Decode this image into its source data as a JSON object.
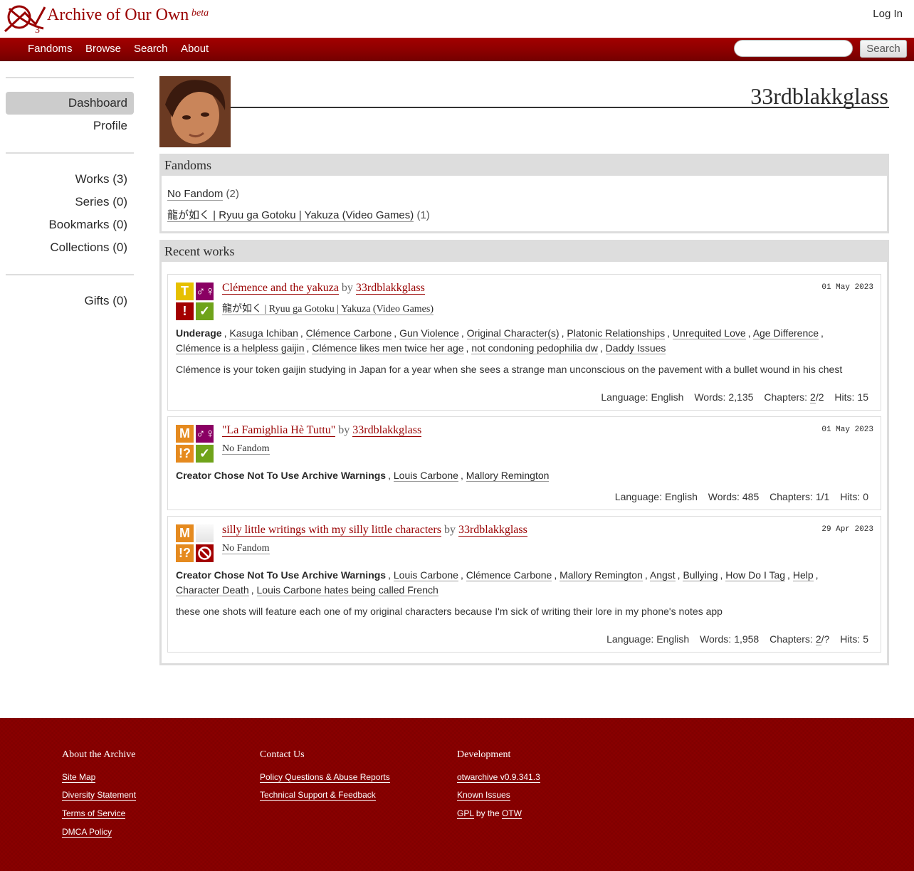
{
  "header": {
    "site_title": "Archive of Our Own",
    "beta": "beta",
    "login": "Log In",
    "logo_icon": "ao3-logo-icon"
  },
  "nav": {
    "items": [
      "Fandoms",
      "Browse",
      "Search",
      "About"
    ],
    "search_value": "",
    "search_button": "Search"
  },
  "sidebar": {
    "primary": [
      "Dashboard",
      "Profile"
    ],
    "counts": [
      "Works (3)",
      "Series (0)",
      "Bookmarks (0)",
      "Collections (0)"
    ],
    "gifts": "Gifts (0)"
  },
  "user": {
    "name": "33rdblakkglass"
  },
  "fandoms_box": {
    "heading": "Fandoms",
    "items": [
      {
        "name": "No Fandom",
        "count": "(2)"
      },
      {
        "name": "龍が如く | Ryuu ga Gotoku | Yakuza (Video Games)",
        "count": "(1)"
      }
    ]
  },
  "recent": {
    "heading": "Recent works",
    "works": [
      {
        "title": "Clémence and the yakuza",
        "by": "by",
        "author": "33rdblakkglass",
        "fandom": "龍が如く | Ryuu ga Gotoku | Yakuza (Video Games)",
        "date": "01 May 2023",
        "icons": {
          "rating": "T",
          "category": "♂♀",
          "warning": "!",
          "status": "✓"
        },
        "warning_tag": "Underage",
        "tags_line1": [
          "Kasuga Ichiban",
          "Clémence Carbone",
          "Gun Violence",
          "Original Character(s)",
          "Platonic Relationships",
          "Unrequited Love",
          "Age Difference"
        ],
        "tags_line2": [
          "Clémence is a helpless gaijin",
          "Clémence likes men twice her age",
          "not condoning pedophilia dw",
          "Daddy Issues"
        ],
        "summary": "Clémence is your token gaijin studying in Japan for a year when she sees a strange man unconscious on the pavement with a bullet wound in his chest",
        "language": "English",
        "words": "2,135",
        "chapters_posted": "2",
        "chapters_total": "/2",
        "hits": "15"
      },
      {
        "title": "\"La Famighlia Hè Tuttu\"",
        "by": "by",
        "author": "33rdblakkglass",
        "fandom": "No Fandom",
        "date": "01 May 2023",
        "icons": {
          "rating": "M",
          "category": "♂♀",
          "warning": "!?",
          "status": "✓"
        },
        "warning_tag": "Creator Chose Not To Use Archive Warnings",
        "tags_line1": [
          "Louis Carbone",
          "Mallory Remington"
        ],
        "summary": "",
        "language": "English",
        "words": "485",
        "chapters": "1/1",
        "hits": "0"
      },
      {
        "title": "silly little writings with my silly little characters",
        "by": "by",
        "author": "33rdblakkglass",
        "fandom": "No Fandom",
        "date": "29 Apr 2023",
        "icons": {
          "rating": "M",
          "category": "",
          "warning": "!?",
          "status": "⃠"
        },
        "warning_tag": "Creator Chose Not To Use Archive Warnings",
        "tags_line1": [
          "Louis Carbone",
          "Clémence Carbone",
          "Mallory Remington",
          "Angst",
          "Bullying",
          "How Do I Tag",
          "Help"
        ],
        "tags_line2": [
          "Character Death",
          "Louis Carbone hates being called French"
        ],
        "summary": "these one shots will feature each one of my original characters because I'm sick of writing their lore in my phone's notes app",
        "language": "English",
        "words": "1,958",
        "chapters_posted": "2",
        "chapters_total": "/?",
        "hits": "5"
      }
    ],
    "labels": {
      "language": "Language:",
      "words": "Words:",
      "chapters": "Chapters:",
      "hits": "Hits:"
    }
  },
  "footer": {
    "about_heading": "About the Archive",
    "about_links": [
      "Site Map",
      "Diversity Statement",
      "Terms of Service",
      "DMCA Policy"
    ],
    "contact_heading": "Contact Us",
    "contact_links": [
      "Policy Questions & Abuse Reports",
      "Technical Support & Feedback"
    ],
    "dev_heading": "Development",
    "dev_links": [
      "otwarchive v0.9.341.3",
      "Known Issues"
    ],
    "gpl": "GPL",
    "by_the": "by the",
    "otw": "OTW"
  },
  "colors": {
    "brand_red": "#990000",
    "nav_red": "#8a0000",
    "teen_yellow": "#e6c000",
    "mature_orange": "#e58a1f",
    "warning_red": "#a30000",
    "complete_green": "#6fa31a",
    "category_purple": "#8a0063"
  }
}
